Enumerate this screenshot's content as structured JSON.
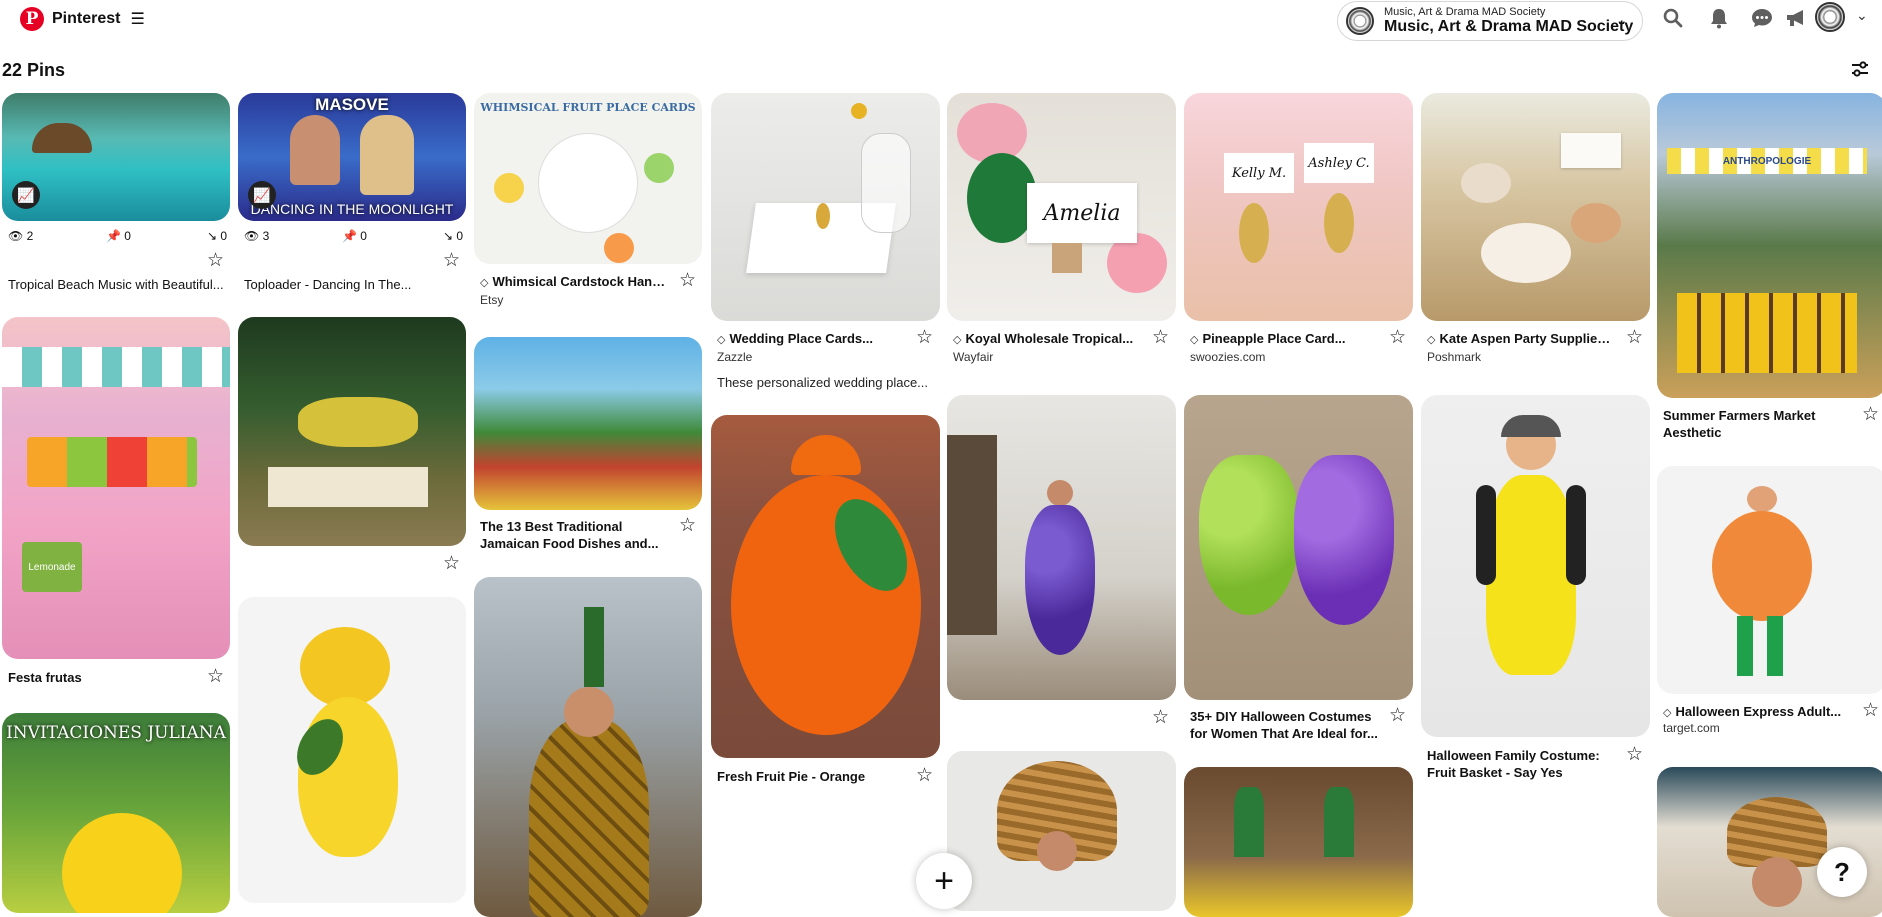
{
  "header": {
    "brand": "Pinterest",
    "account_small": "Music, Art & Drama MAD Society",
    "account_name": "Music, Art & Drama MAD Society",
    "icons": [
      "search-icon",
      "bell-icon",
      "messages-icon",
      "megaphone-icon"
    ]
  },
  "pin_count": "22 Pins",
  "pins": {
    "p1": {
      "title": "Tropical Beach Music with Beautiful...",
      "views": "2",
      "saves": "0",
      "clicks": "0"
    },
    "p2": {
      "title": "Toploader - Dancing In The...",
      "views": "3",
      "saves": "0",
      "clicks": "0",
      "banner_top": "MASOVE",
      "banner_bottom": "DANCING IN THE MOONLIGHT"
    },
    "p3": {
      "title": "Whimsical Cardstock Hand...",
      "source": "Etsy",
      "image_text": "WHIMSICAL FRUIT PLACE CARDS"
    },
    "p4": {
      "title": "Wedding Place Cards...",
      "source": "Zazzle",
      "desc": "These personalized wedding place..."
    },
    "p5": {
      "title": "Koyal Wholesale Tropical...",
      "source": "Wayfair",
      "image_text": "Amelia"
    },
    "p6": {
      "title": "Pineapple Place Card...",
      "source": "swoozies.com",
      "image_text_1": "Kelly M.",
      "image_text_2": "Ashley C."
    },
    "p7": {
      "title": "Kate Aspen Party Supplies ...",
      "source": "Poshmark"
    },
    "p8": {
      "title": "Summer Farmers Market Aesthetic",
      "image_text": "ANTHROPOLOGIE"
    },
    "p9": {
      "title": "Festa frutas",
      "image_text": "Lemonade"
    },
    "p10": {
      "title": ""
    },
    "p11": {
      "title": "The 13 Best Traditional Jamaican Food Dishes and..."
    },
    "p12": {
      "title": "Fresh Fruit Pie - Orange"
    },
    "p13": {
      "title": ""
    },
    "p14": {
      "title": "35+ DIY Halloween Costumes for Women That Are Ideal for..."
    },
    "p15": {
      "title": "Halloween Family Costume: Fruit Basket - Say Yes"
    },
    "p16": {
      "title": "Halloween Express Adult...",
      "source": "target.com"
    },
    "p17": {
      "image_text": "INVITACIONES JULIANA"
    }
  }
}
